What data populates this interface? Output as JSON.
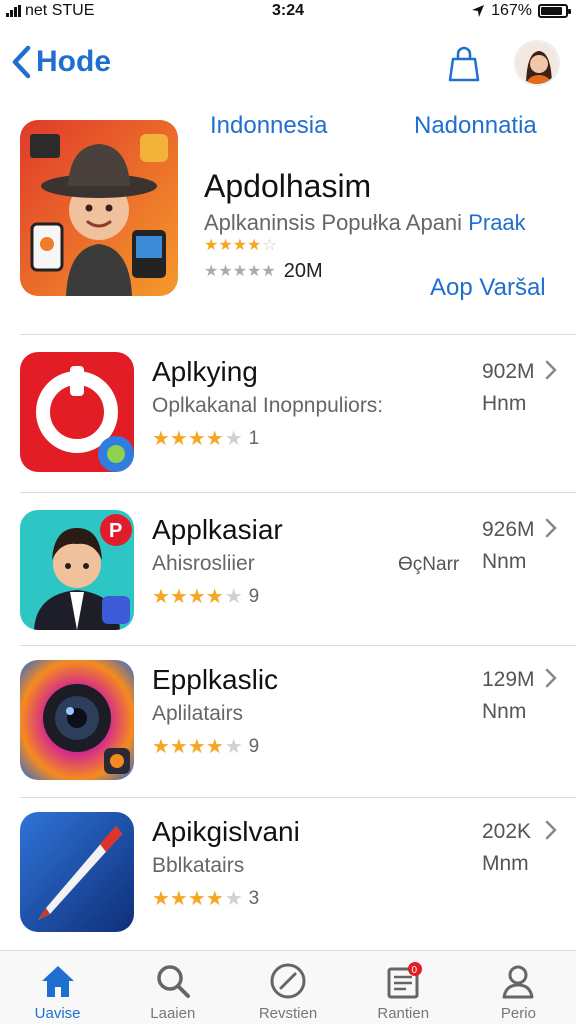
{
  "status_bar": {
    "carrier": "net STUE",
    "time": "3:24",
    "battery": "167%",
    "battery_level": 0.9
  },
  "nav": {
    "back_label": "Hode",
    "back_icon": "chevron-left-icon",
    "bag_icon": "bag-icon"
  },
  "featured": {
    "tag_left": "Indonnesia",
    "tag_right": "Nadonnatia",
    "title": "Apdolhasim",
    "subtitle": "Aplkaninsis Popułka Apani",
    "subtitle_accent": "Praak",
    "rating_count": "20M",
    "button_label": "Aop Varšal"
  },
  "apps": [
    {
      "name": "Aplkying",
      "subtitle": "Oplkakanal Inopnpuliors:",
      "size": "902M",
      "unit": "Hnm",
      "rating_count": "1",
      "extra": ""
    },
    {
      "name": "Applkasiar",
      "subtitle": "Ahisrosliier",
      "size": "926M",
      "unit": "Nnm",
      "rating_count": "9",
      "extra": "ϴçNarr"
    },
    {
      "name": "Epplkaslic",
      "subtitle": "Aplilatairs",
      "size": "129M",
      "unit": "Nnm",
      "rating_count": "9",
      "extra": ""
    },
    {
      "name": "Apikgislvani",
      "subtitle": "Bblkatairs",
      "size": "202K",
      "unit": "Mnm",
      "rating_count": "3",
      "extra": ""
    }
  ],
  "tabs": [
    {
      "label": "Uavise",
      "icon": "home-icon",
      "active": true
    },
    {
      "label": "Laaien",
      "icon": "search-icon",
      "active": false
    },
    {
      "label": "Revstien",
      "icon": "compass-icon",
      "active": false
    },
    {
      "label": "Rantien",
      "icon": "updates-icon",
      "active": false,
      "badge": "0"
    },
    {
      "label": "Perio",
      "icon": "profile-icon",
      "active": false
    }
  ],
  "colors": {
    "accent": "#1f6fd1",
    "star": "#f5a623",
    "divider": "#dcdcdc"
  }
}
